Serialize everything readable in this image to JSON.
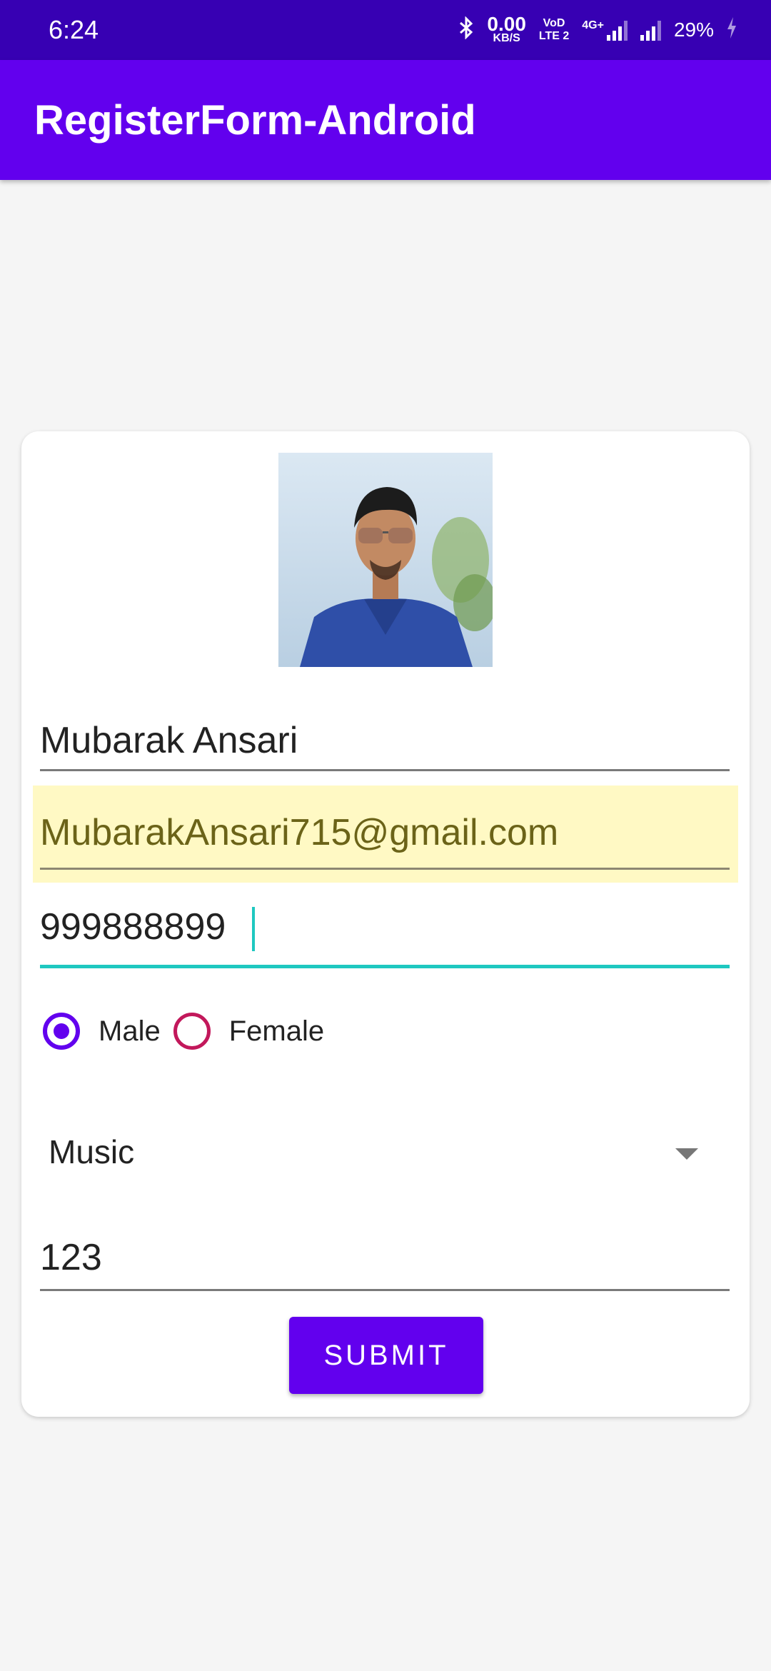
{
  "status_bar": {
    "time": "6:24",
    "network_speed": "0.00",
    "network_speed_unit": "KB/S",
    "volte_top": "VoD",
    "volte_bottom": "LTE 2",
    "net_type": "4G+",
    "battery": "29%"
  },
  "app_bar": {
    "title": "RegisterForm-Android"
  },
  "form": {
    "name_value": "Mubarak Ansari",
    "email_value": "MubarakAnsari715@gmail.com",
    "phone_value": "999888899",
    "gender_options": [
      {
        "label": "Male",
        "checked": true
      },
      {
        "label": "Female",
        "checked": false
      }
    ],
    "hobby_selected": "Music",
    "password_value": "123",
    "submit_label": "SUBMIT"
  },
  "colors": {
    "primary": "#6200ee",
    "status_bar": "#3700b3",
    "autofill_highlight": "#fff9c4",
    "focus_accent": "#1ec8c0",
    "female_radio": "#c2185b"
  }
}
